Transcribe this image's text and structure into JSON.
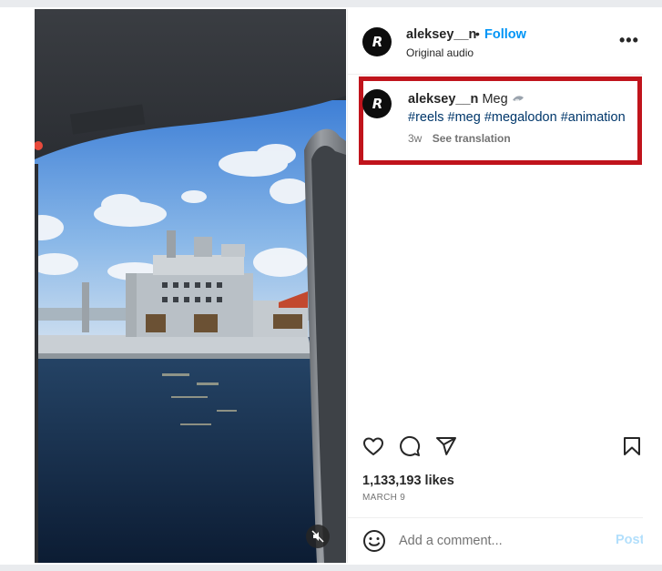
{
  "post": {
    "username": "aleksey__n",
    "separator": "•",
    "follow_label": "Follow",
    "audio_label": "Original audio",
    "more_label": "•••",
    "avatar_text": "R"
  },
  "caption": {
    "username": "aleksey__n",
    "text": "Meg",
    "hashtags": [
      "#reels",
      "#meg",
      "#megalodon",
      "#animation"
    ],
    "time_ago": "3w",
    "translate_label": "See translation"
  },
  "actions": {
    "icons": [
      "heart-icon",
      "comment-icon",
      "share-icon",
      "bookmark-icon"
    ]
  },
  "stats": {
    "likes": "1,133,193 likes",
    "date": "MARCH 9"
  },
  "comment": {
    "placeholder": "Add a comment...",
    "post_label": "Post"
  },
  "media": {
    "muted": true
  },
  "colors": {
    "accent": "#0095f6",
    "hashtag": "#00376b",
    "highlight": "#c0141c",
    "post_disabled": "#b2dffc"
  }
}
